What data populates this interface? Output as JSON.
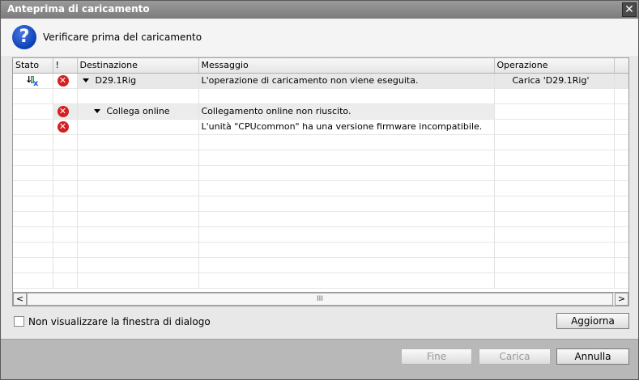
{
  "window": {
    "title": "Anteprima di caricamento",
    "close_glyph": "✕"
  },
  "header": {
    "icon": "question-icon",
    "heading": "Verificare prima del caricamento"
  },
  "grid": {
    "columns": [
      "Stato",
      "!",
      "Destinazione",
      "Messaggio",
      "Operazione"
    ],
    "rows": [
      {
        "destination": "D29.1Rig",
        "message": "L'operazione di caricamento non viene eseguita.",
        "operation": "Carica 'D29.1Rig'"
      },
      {
        "destination": "Collega online",
        "message": "Collegamento online non riuscito.",
        "operation": ""
      },
      {
        "destination": "",
        "message": "L'unità \"CPUcommon\" ha una versione firmware incompatibile.",
        "operation": ""
      }
    ]
  },
  "scrollbar": {
    "left": "<",
    "right": ">",
    "grip": "III"
  },
  "options": {
    "dont_show_label": "Non visualizzare la finestra di dialogo"
  },
  "buttons": {
    "refresh": "Aggiorna",
    "finish": "Fine",
    "load": "Carica",
    "cancel": "Annulla"
  },
  "colors": {
    "error": "#d42020",
    "question": "#0b3fb8"
  }
}
